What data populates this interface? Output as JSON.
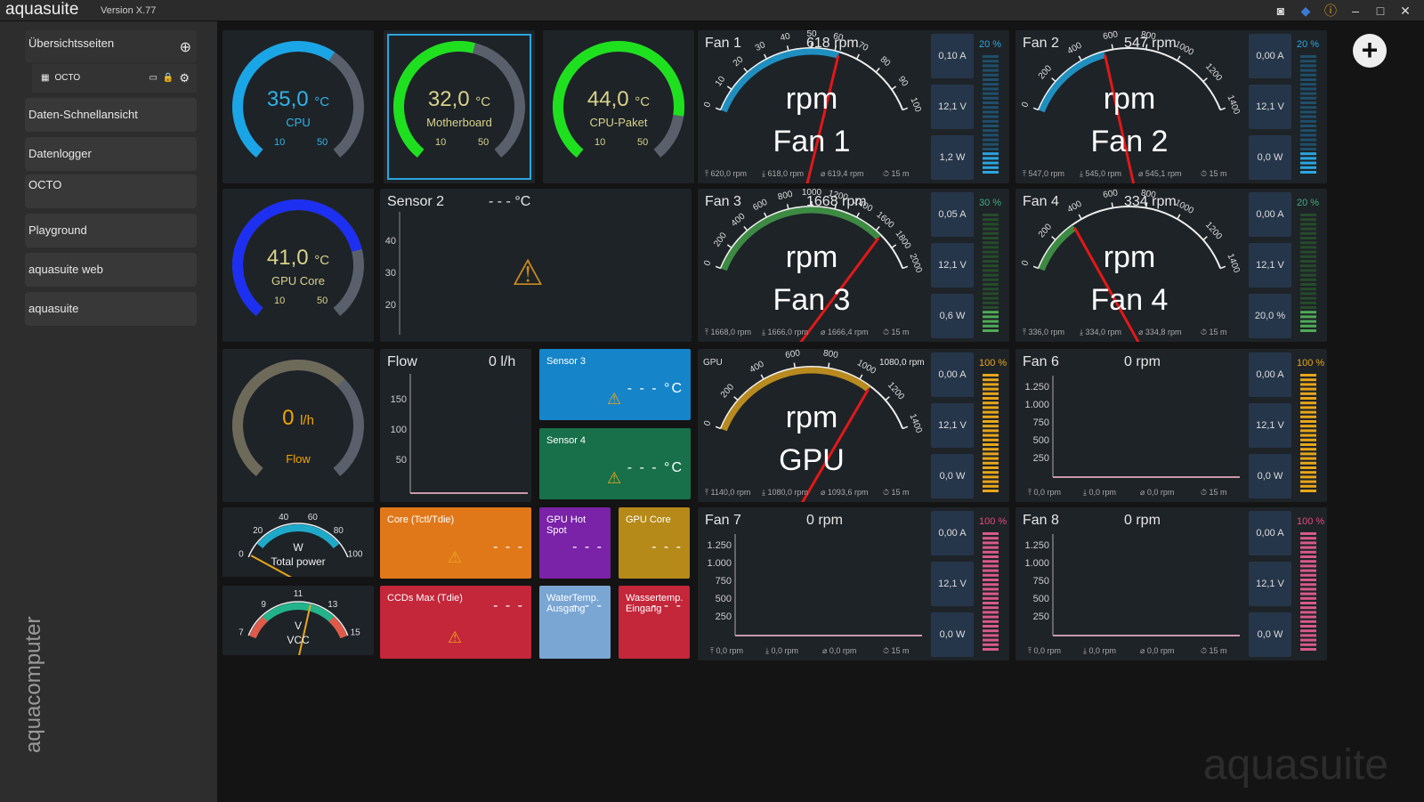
{
  "app": {
    "name": "aquasuite",
    "version": "Version X.77"
  },
  "sidebar": {
    "header": "Übersichtsseiten",
    "active": "OCTO",
    "items": [
      "Daten-Schnellansicht",
      "Datenlogger",
      "OCTO",
      "Playground",
      "aquasuite web",
      "aquasuite"
    ],
    "vendor": "aquacomputer"
  },
  "gauges": [
    {
      "value": "35,0",
      "unit": "°C",
      "label": "CPU",
      "min": "10",
      "max": "50",
      "frac": 0.62,
      "color": "#1aa5e6"
    },
    {
      "value": "32,0",
      "unit": "°C",
      "label": "Motherboard",
      "min": "10",
      "max": "50",
      "frac": 0.55,
      "color": "#1fe01f"
    },
    {
      "value": "44,0",
      "unit": "°C",
      "label": "CPU-Paket",
      "min": "10",
      "max": "50",
      "frac": 0.85,
      "color": "#1fe01f"
    },
    {
      "value": "41,0",
      "unit": "°C",
      "label": "GPU Core",
      "min": "10",
      "max": "50",
      "frac": 0.77,
      "color": "#1d2ff0"
    },
    {
      "value": "0",
      "unit": "l/h",
      "label": "Flow",
      "frac": 0,
      "color": "#f0a500"
    }
  ],
  "fans": [
    {
      "title": "Fan 1",
      "rpm": "618 rpm",
      "name": "Fan 1",
      "unit": "rpm",
      "amp": "0,10 A",
      "volt": "12,1 V",
      "pw": "1,2 W",
      "pct": "20 %",
      "ticks": [
        "0",
        "10",
        "20",
        "30",
        "40",
        "50",
        "60",
        "70",
        "80",
        "90",
        "100"
      ],
      "arc": "#1f8fc0",
      "frac": 0.62,
      "s1": "620,0 rpm",
      "s2": "618,0 rpm",
      "s3": "619,4 rpm",
      "s4": "15 m"
    },
    {
      "title": "Fan 2",
      "rpm": "547 rpm",
      "name": "Fan 2",
      "unit": "rpm",
      "amp": "0,00 A",
      "volt": "12,1 V",
      "pw": "0,0 W",
      "pct": "20 %",
      "ticks": [
        "0",
        "200",
        "400",
        "600",
        "800",
        "1000",
        "1200",
        "1400"
      ],
      "arc": "#1f8fc0",
      "frac": 0.39,
      "s1": "547,0 rpm",
      "s2": "545,0 rpm",
      "s3": "545,1 rpm",
      "s4": "15 m"
    },
    {
      "title": "Fan 3",
      "rpm": "1668 rpm",
      "name": "Fan 3",
      "unit": "rpm",
      "amp": "0,05 A",
      "volt": "12,1 V",
      "pw": "0,6 W",
      "pct": "30 %",
      "ticks": [
        "0",
        "200",
        "400",
        "600",
        "800",
        "1000",
        "1200",
        "1400",
        "1600",
        "1800",
        "2000"
      ],
      "arc": "#3d8a43",
      "frac": 0.83,
      "s1": "1668,0 rpm",
      "s2": "1666,0 rpm",
      "s3": "1666,4 rpm",
      "s4": "15 m"
    },
    {
      "title": "Fan 4",
      "rpm": "334 rpm",
      "name": "Fan 4",
      "unit": "rpm",
      "amp": "0,00 A",
      "volt": "12,1 V",
      "pw": "20,0 %",
      "pct": "20 %",
      "ticks": [
        "0",
        "200",
        "400",
        "600",
        "800",
        "1000",
        "1200",
        "1400"
      ],
      "arc": "#3d8a43",
      "frac": 0.24,
      "s1": "336,0 rpm",
      "s2": "334,0 rpm",
      "s3": "334,8 rpm",
      "s4": "15 m"
    },
    {
      "title": "GPU",
      "rpm": "1080,0 rpm",
      "name": "GPU",
      "unit": "rpm",
      "amp": "0,00 A",
      "volt": "12,1 V",
      "pw": "0,0 W",
      "pct": "100 %",
      "ticks": [
        "0",
        "200",
        "400",
        "600",
        "800",
        "1000",
        "1200",
        "1400"
      ],
      "arc": "#b88a1f",
      "frac": 0.77,
      "s1": "1140,0 rpm",
      "s2": "1080,0 rpm",
      "s3": "1093,6 rpm",
      "s4": "15 m"
    }
  ],
  "plots": [
    {
      "title": "Fan 6",
      "rpm": "0 rpm",
      "amp": "0,00 A",
      "volt": "12,1 V",
      "pw": "0,0 W",
      "pct": "100 %",
      "yt": [
        "1.250",
        "1.000",
        "750",
        "500",
        "250"
      ],
      "s1": "0,0 rpm",
      "s2": "0,0 rpm",
      "s3": "0,0 rpm",
      "s4": "15 m"
    },
    {
      "title": "Fan 7",
      "rpm": "0 rpm",
      "amp": "0,00 A",
      "volt": "12,1 V",
      "pw": "0,0 W",
      "pct": "100 %",
      "yt": [
        "1.250",
        "1.000",
        "750",
        "500",
        "250"
      ],
      "s1": "0,0 rpm",
      "s2": "0,0 rpm",
      "s3": "0,0 rpm",
      "s4": "15 m"
    },
    {
      "title": "Fan 8",
      "rpm": "0 rpm",
      "amp": "0,00 A",
      "volt": "12,1 V",
      "pw": "0,0 W",
      "pct": "100 %",
      "yt": [
        "1.250",
        "1.000",
        "750",
        "500",
        "250"
      ],
      "s1": "0,0 rpm",
      "s2": "0,0 rpm",
      "s3": "0,0 rpm",
      "s4": "15 m"
    }
  ],
  "sensor2": {
    "title": "Sensor 2",
    "value": "- - - °C",
    "yt": [
      "40",
      "30",
      "20"
    ]
  },
  "flowchart": {
    "title": "Flow",
    "value": "0 l/h",
    "yt": [
      "150",
      "100",
      "50"
    ]
  },
  "sensors": {
    "s3": "Sensor 3",
    "s4": "Sensor 4",
    "temp": "- - - °C",
    "core": "Core (Tctl/Tdie)",
    "gpuhot": "GPU Hot Spot",
    "gpucore": "GPU Core",
    "ccd": "CCDs Max (Tdie)",
    "wout": "WaterTemp. Ausgang",
    "win": "Wassertemp. Eingang",
    "nodata": "- - -"
  },
  "power": {
    "unit": "W",
    "label": "Total power",
    "ticks": [
      "0",
      "20",
      "40",
      "60",
      "80",
      "100"
    ]
  },
  "vcc": {
    "unit": "V",
    "label": "VCC",
    "ticks": [
      "7",
      "9",
      "11",
      "13",
      "15"
    ]
  },
  "watermark": "aquasuite"
}
